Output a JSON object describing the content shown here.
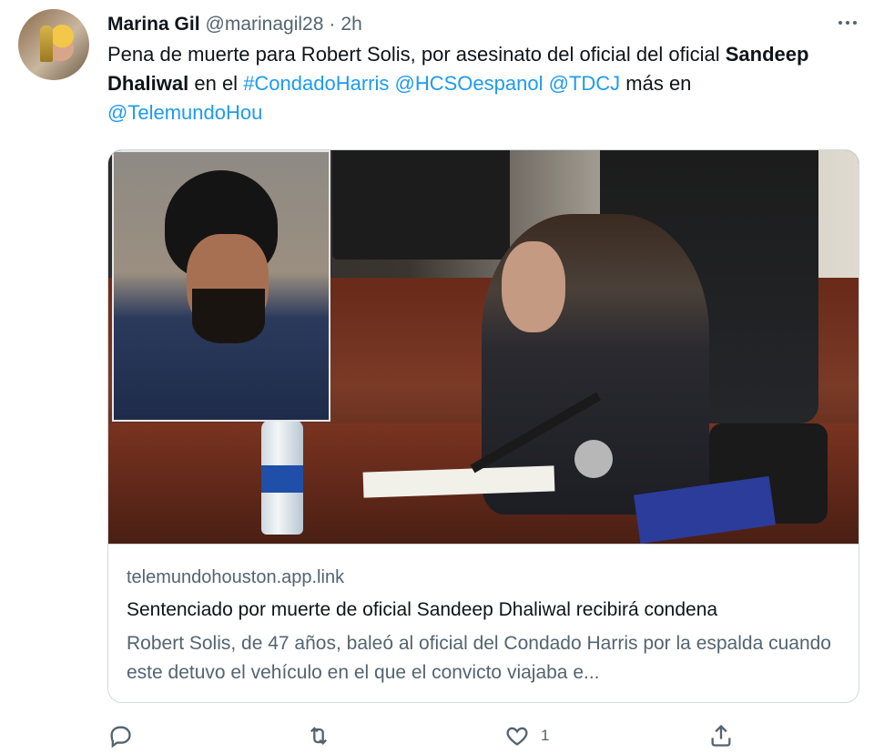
{
  "tweet": {
    "author_name": "Marina Gil",
    "handle": "@marinagil28",
    "separator": "·",
    "time": "2h",
    "text": {
      "part1": "Pena de muerte para Robert Solis, por asesinato del oficial del oficial ",
      "bold_name": "Sandeep Dhaliwal",
      "part2": " en el ",
      "hashtag": "#CondadoHarris",
      "mention1": "@HCSOespanol",
      "mention2": "@TDCJ",
      "part3": " más en ",
      "mention3": "@TelemundoHou"
    }
  },
  "card": {
    "domain": "telemundohouston.app.link",
    "title": "Sentenciado por muerte de oficial Sandeep Dhaliwal recibirá condena",
    "description": "Robert Solis, de 47 años, baleó al oficial del Condado Harris por la espalda cuando este detuvo el vehículo en el que el convicto viajaba e..."
  },
  "actions": {
    "reply_icon": "reply-icon",
    "retweet_icon": "retweet-icon",
    "like_icon": "heart-icon",
    "like_count": "1",
    "share_icon": "share-icon"
  },
  "colors": {
    "link": "#1d9bf0",
    "secondary_text": "#536471",
    "primary_text": "#0f1419",
    "border": "#cfd9de"
  }
}
